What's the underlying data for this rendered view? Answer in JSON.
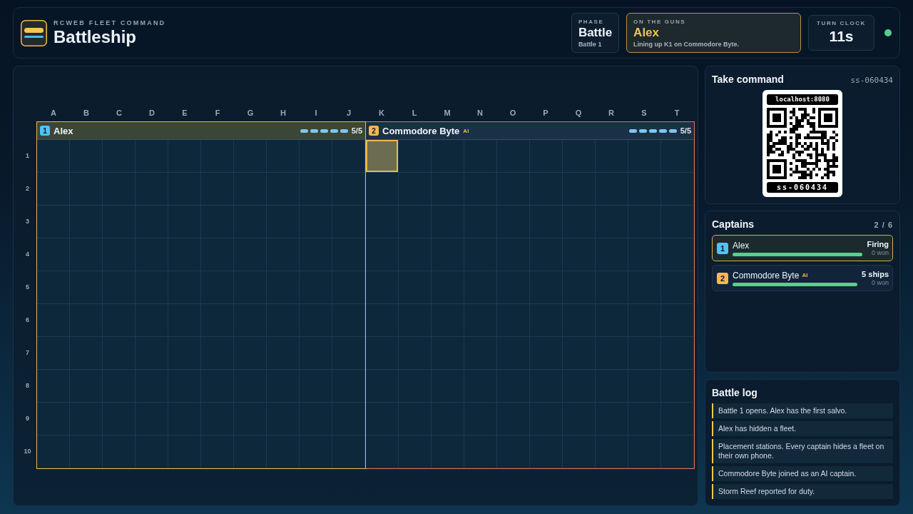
{
  "header": {
    "eyebrow": "RCWEB FLEET COMMAND",
    "title": "Battleship"
  },
  "status": {
    "phase": {
      "label": "PHASE",
      "value": "Battle",
      "detail": "Battle 1"
    },
    "turn": {
      "label": "ON THE GUNS",
      "value": "Alex",
      "detail": "Lining up K1 on Commodore Byte."
    },
    "clock": {
      "label": "TURN CLOCK",
      "value": "11s"
    },
    "connected": true
  },
  "board": {
    "column_labels": [
      "A",
      "B",
      "C",
      "D",
      "E",
      "F",
      "G",
      "H",
      "I",
      "J",
      "K",
      "L",
      "M",
      "N",
      "O",
      "P",
      "Q",
      "R",
      "S",
      "T"
    ],
    "row_labels": [
      "1",
      "2",
      "3",
      "4",
      "5",
      "6",
      "7",
      "8",
      "9",
      "10"
    ],
    "fleets": [
      {
        "number": "1",
        "color": "#4fc3f7",
        "name": "Alex",
        "active": true,
        "targeted": false,
        "ships": [
          {
            "sunk": false
          },
          {
            "sunk": false
          },
          {
            "sunk": false
          },
          {
            "sunk": false
          },
          {
            "sunk": false
          }
        ],
        "count": "5/5",
        "aimed": [
          [
            false,
            false,
            false,
            false,
            false,
            false,
            false,
            false,
            false,
            false
          ],
          [
            false,
            false,
            false,
            false,
            false,
            false,
            false,
            false,
            false,
            false
          ],
          [
            false,
            false,
            false,
            false,
            false,
            false,
            false,
            false,
            false,
            false
          ],
          [
            false,
            false,
            false,
            false,
            false,
            false,
            false,
            false,
            false,
            false
          ],
          [
            false,
            false,
            false,
            false,
            false,
            false,
            false,
            false,
            false,
            false
          ],
          [
            false,
            false,
            false,
            false,
            false,
            false,
            false,
            false,
            false,
            false
          ],
          [
            false,
            false,
            false,
            false,
            false,
            false,
            false,
            false,
            false,
            false
          ],
          [
            false,
            false,
            false,
            false,
            false,
            false,
            false,
            false,
            false,
            false
          ],
          [
            false,
            false,
            false,
            false,
            false,
            false,
            false,
            false,
            false,
            false
          ],
          [
            false,
            false,
            false,
            false,
            false,
            false,
            false,
            false,
            false,
            false
          ]
        ]
      },
      {
        "number": "2",
        "color": "#ffb74d",
        "name": "Commodore Byte",
        "ai_tag": "AI",
        "active": false,
        "targeted": true,
        "ships": [
          {
            "sunk": false
          },
          {
            "sunk": false
          },
          {
            "sunk": false
          },
          {
            "sunk": false
          },
          {
            "sunk": false
          }
        ],
        "count": "5/5",
        "aimed": [
          [
            true,
            false,
            false,
            false,
            false,
            false,
            false,
            false,
            false,
            false
          ],
          [
            false,
            false,
            false,
            false,
            false,
            false,
            false,
            false,
            false,
            false
          ],
          [
            false,
            false,
            false,
            false,
            false,
            false,
            false,
            false,
            false,
            false
          ],
          [
            false,
            false,
            false,
            false,
            false,
            false,
            false,
            false,
            false,
            false
          ],
          [
            false,
            false,
            false,
            false,
            false,
            false,
            false,
            false,
            false,
            false
          ],
          [
            false,
            false,
            false,
            false,
            false,
            false,
            false,
            false,
            false,
            false
          ],
          [
            false,
            false,
            false,
            false,
            false,
            false,
            false,
            false,
            false,
            false
          ],
          [
            false,
            false,
            false,
            false,
            false,
            false,
            false,
            false,
            false,
            false
          ],
          [
            false,
            false,
            false,
            false,
            false,
            false,
            false,
            false,
            false,
            false
          ],
          [
            false,
            false,
            false,
            false,
            false,
            false,
            false,
            false,
            false,
            false
          ]
        ]
      }
    ]
  },
  "join": {
    "title": "Take command",
    "room": "ss-060434",
    "qr": {
      "host": "localhost:8080",
      "code": "ss-060434"
    }
  },
  "captains": {
    "title": "Captains",
    "count": "2 / 6",
    "items": [
      {
        "number": "1",
        "color": "#4fc3f7",
        "name": "Alex",
        "status": "Firing",
        "wins": "0 won",
        "level": 1,
        "selected": true
      },
      {
        "number": "2",
        "color": "#ffb74d",
        "name": "Commodore Byte",
        "ai_tag": "AI",
        "status": "5 ships",
        "wins": "0 won",
        "level": 1,
        "selected": false
      }
    ]
  },
  "log": {
    "title": "Battle log",
    "entries": [
      "Battle 1 opens. Alex has the first salvo.",
      "Alex has hidden a fleet.",
      "Placement stations. Every captain hides a fleet on their own phone.",
      "Commodore Byte joined as an AI captain.",
      "Storm Reef reported for duty."
    ]
  }
}
